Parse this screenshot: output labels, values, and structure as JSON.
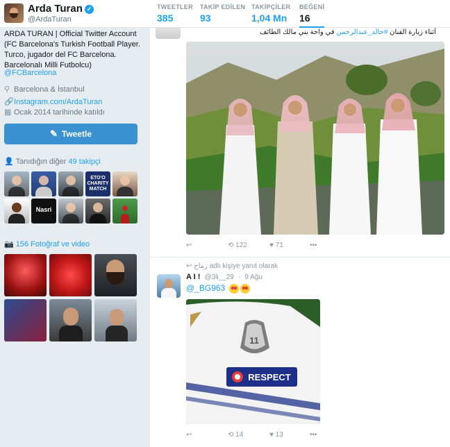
{
  "profile": {
    "name": "Arda Turan",
    "handle": "@ArdaTuran",
    "bio": "ARDA TURAN | Official Twitter Account (FC Barcelona's Turkish Football Player. Turco, jugador del FC Barcelona. Barcelonalı Milli Futbolcu)",
    "mention": "@FCBarcelona",
    "location": "Barcelona & İstanbul",
    "website": "Instagram.com/ArdaTuran",
    "joined": "Ocak 2014 tarihinde katıldı"
  },
  "stats": [
    {
      "label": "TWEETLER",
      "value": "385"
    },
    {
      "label": "TAKİP EDİLEN",
      "value": "93"
    },
    {
      "label": "TAKİPÇİLER",
      "value": "1,04 Mn"
    },
    {
      "label": "BEĞENİ",
      "value": "16"
    }
  ],
  "tweet_button": {
    "label": "Tweetle"
  },
  "followers_known": {
    "prefix": "Tanıdığın diğer",
    "link": "49 takipçi"
  },
  "follower_tiles": [
    {
      "text": ""
    },
    {
      "text": ""
    },
    {
      "text": ""
    },
    {
      "text": "ETO'O CHARITY MATCH"
    },
    {
      "text": ""
    },
    {
      "text": ""
    },
    {
      "text": "Nasri"
    },
    {
      "text": ""
    },
    {
      "text": ""
    },
    {
      "text": ""
    }
  ],
  "media": {
    "header": "156 Fotoğraf ve video"
  },
  "tweets": [
    {
      "text_prefix": "أثناء زيارة الفنان",
      "hashtag": "#خالد_عبدالرحمن",
      "text_suffix": "في واحة ‎بني مالك الطائف",
      "actions": {
        "retweets": "122",
        "likes": "71"
      }
    },
    {
      "reply_context": "adlı kişiye yanıt olarak",
      "reply_user": "رماح",
      "name": "A I !",
      "handle": "@3li__29",
      "date": "9 Ağu",
      "sep": "·",
      "text": "@_BG963",
      "badge_text": "RESPECT",
      "badge_number": "11",
      "actions": {
        "retweets": "14",
        "likes": "13"
      }
    }
  ],
  "colors": {
    "accent": "#1da1f2",
    "button": "#3a93d0",
    "bg": "#e6ecf0"
  }
}
